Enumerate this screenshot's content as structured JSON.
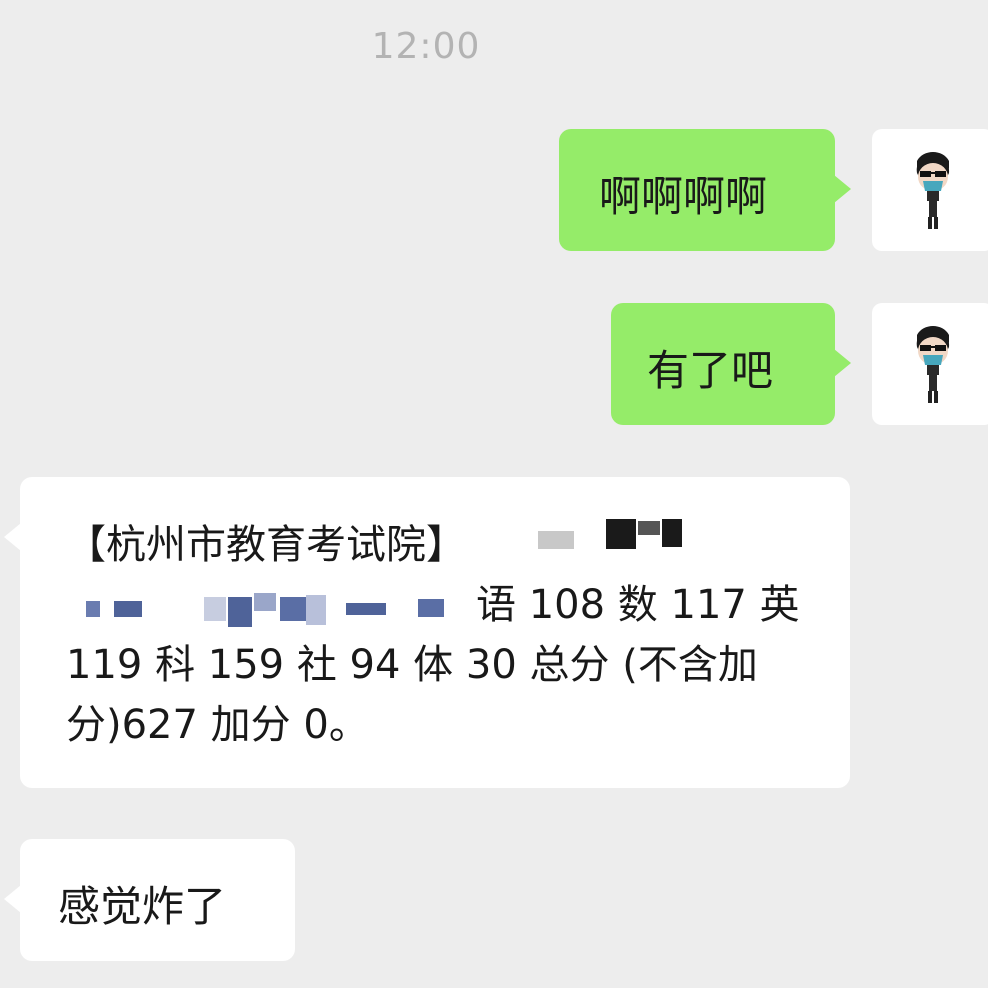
{
  "timestamp": "12:00",
  "messages": [
    {
      "direction": "outgoing",
      "text": "啊啊啊啊"
    },
    {
      "direction": "outgoing",
      "text": "有了吧"
    },
    {
      "direction": "incoming",
      "lines": [
        "【杭州市教育考试院】",
        "语 108 数 117 英",
        "119 科 159 社 94 体 30 总分 (不含加",
        "分)627 加分 0。"
      ]
    },
    {
      "direction": "incoming",
      "text": "感觉炸了"
    }
  ],
  "colors": {
    "background": "#ededed",
    "outgoing_bubble": "#95ec69",
    "incoming_bubble": "#ffffff",
    "timestamp": "#b3b3b3",
    "text": "#191919",
    "mosaic_blue": "#5a6ea5",
    "mosaic_dark": "#1a1a1a"
  },
  "avatar": {
    "icon": "cartoon-person-avatar-icon"
  }
}
